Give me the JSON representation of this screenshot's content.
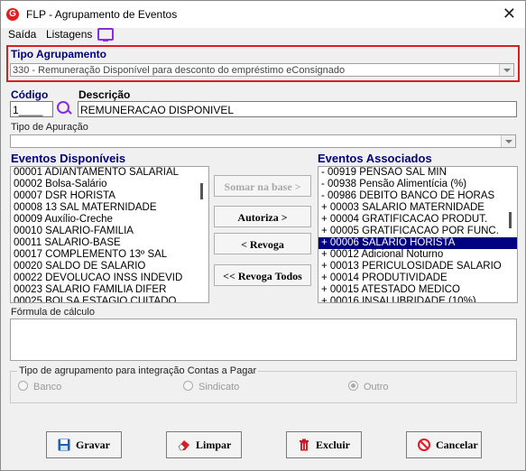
{
  "window": {
    "title": "FLP - Agrupamento de Eventos",
    "close_glyph": "✕",
    "app_icon_letter": "G"
  },
  "menu": {
    "items": [
      "Saída",
      "Listagens"
    ]
  },
  "tipo_agrupamento": {
    "label": "Tipo Agrupamento",
    "value": "330 - Remuneração Disponível para desconto do empréstimo eConsignado"
  },
  "codigo": {
    "label": "Código",
    "value": "1____"
  },
  "descricao": {
    "label": "Descrição",
    "value": "REMUNERACAO DISPONIVEL"
  },
  "tipo_apuracao": {
    "label": "Tipo de Apuração",
    "value": ""
  },
  "eventos_disponiveis": {
    "label": "Eventos Disponíveis",
    "items": [
      "00001 ADIANTAMENTO SALARIAL",
      "00002 Bolsa-Salário",
      "00007 DSR HORISTA",
      "00008 13 SAL MATERNIDADE",
      "00009 Auxílio-Creche",
      "00010 SALARIO-FAMILIA",
      "00011 SALARIO-BASE",
      "00017 COMPLEMENTO 13º SAL",
      "00020 SALDO DE SALARIO",
      "00022 DEVOLUCAO INSS INDEVID",
      "00023 SALARIO FAMILIA DIFER",
      "00025 BOLSA ESTAGIO CUITADO"
    ]
  },
  "eventos_associados": {
    "label": "Eventos Associados",
    "items": [
      "- 00919 PENSAO SAL MIN",
      "- 00938 Pensão Alimentícia (%)",
      "- 00986 DEBITO BANCO DE HORAS",
      "+ 00003 SALARIO MATERNIDADE",
      "+ 00004 GRATIFICACAO PRODUT.",
      "+ 00005 GRATIFICACAO POR FUNC.",
      "+ 00006 SALARIO HORISTA",
      "+ 00012 Adicional Noturno",
      "+ 00013 PERICULOSIDADE SALARIO",
      "+ 00014 PRODUTIVIDADE",
      "+ 00015 ATESTADO MEDICO",
      "+ 00016 INSALUBRIDADE (10%)"
    ],
    "selected": "+ 00006 SALARIO HORISTA"
  },
  "mid_buttons": {
    "somar": "Somar na base >",
    "autoriza": "Autoriza >",
    "revoga": "< Revoga",
    "revoga_todos": "<< Revoga Todos"
  },
  "formula": {
    "label": "Fórmula de cálculo"
  },
  "integracao": {
    "label": "Tipo de agrupamento para integração Contas a Pagar",
    "options": [
      "Banco",
      "Sindicato",
      "Outro"
    ],
    "selected": "Outro"
  },
  "buttons": {
    "gravar": "Gravar",
    "limpar": "Limpar",
    "excluir": "Excluir",
    "cancelar": "Cancelar"
  },
  "colors": {
    "accent_blue": "#000080",
    "highlight": "#d82020"
  }
}
